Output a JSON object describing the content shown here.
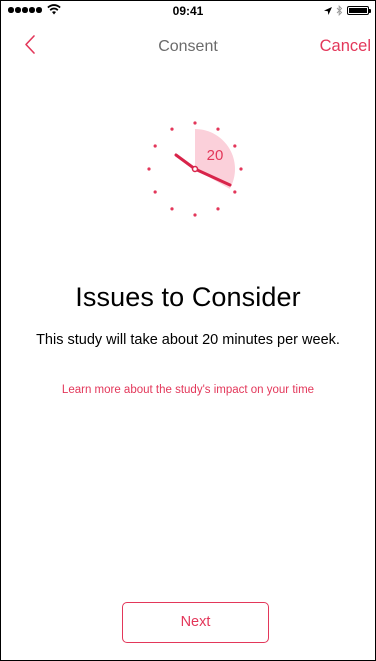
{
  "status_bar": {
    "time": "09:41"
  },
  "nav": {
    "title": "Consent",
    "cancel_label": "Cancel"
  },
  "illustration": {
    "minutes_label": "20",
    "minutes_fraction": 0.333
  },
  "content": {
    "title": "Issues to Consider",
    "body": "This study will take about 20 minutes per week.",
    "link_text": "Learn more about the study's impact on your time"
  },
  "footer": {
    "next_label": "Next"
  },
  "colors": {
    "accent": "#e3375a",
    "accent_light": "#fbd0da",
    "nav_title": "#6b6b6b"
  },
  "icons": {
    "back": "chevron-left-icon",
    "wifi": "wifi-icon",
    "location": "location-arrow-icon",
    "bluetooth": "bluetooth-icon",
    "battery": "battery-icon"
  }
}
